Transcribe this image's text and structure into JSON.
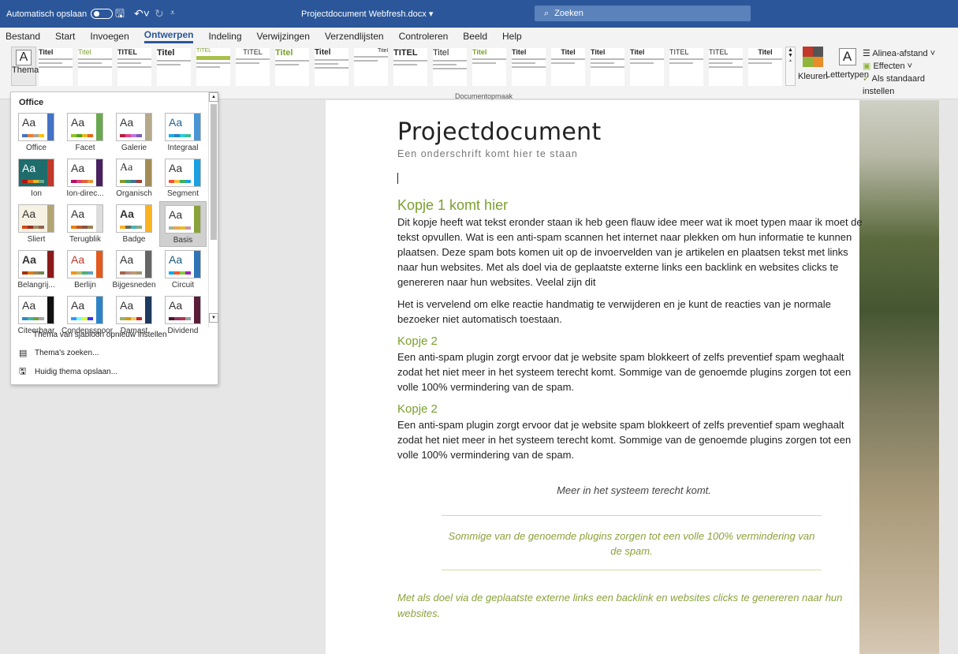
{
  "titlebar": {
    "autosave_label": "Automatisch opslaan",
    "autosave_state": "off",
    "document_title": "Projectdocument Webfresh.docx ▾",
    "search_placeholder": "Zoeken"
  },
  "menu": {
    "tabs": [
      "Bestand",
      "Start",
      "Invoegen",
      "Ontwerpen",
      "Indeling",
      "Verwijzingen",
      "Verzendlijsten",
      "Controleren",
      "Beeld",
      "Help"
    ],
    "active_tab": "Ontwerpen"
  },
  "ribbon": {
    "themes_label": "Thema's",
    "group_label": "Documentopmaak",
    "colors_label": "Kleuren",
    "fonts_label": "Lettertypen",
    "paragraph_spacing_label": "Alinea-afstand ˅",
    "effects_label": "Effecten ˅",
    "set_default_label": "Als standaard instellen",
    "style_titles": [
      "Titel",
      "Titel",
      "TITEL",
      "Titel",
      "TITEL",
      "TITEL",
      "Titel",
      "Titel",
      "Titel",
      "TITEL",
      "Titel",
      "Titel",
      "Titel",
      "Titel",
      "Titel",
      "Titel",
      "TITEL",
      "TITEL",
      "Titel"
    ]
  },
  "theme_panel": {
    "header": "Office",
    "themes": [
      "Office",
      "Facet",
      "Galerie",
      "Integraal",
      "Ion",
      "Ion-direc...",
      "Organisch",
      "Segment",
      "Sliert",
      "Terugblik",
      "Badge",
      "Basis",
      "Belangrij...",
      "Berlijn",
      "Bijgesneden",
      "Circuit",
      "Citeerbaar",
      "Condensspoor",
      "Damast",
      "Dividend"
    ],
    "selected_theme": "Basis",
    "reset_label": "Thema van sjabloon opnieuw instellen",
    "browse_label": "Thema's zoeken...",
    "save_label": "Huidig thema opslaan..."
  },
  "document": {
    "title": "Projectdocument",
    "subtitle": "Een onderschrift komt hier te staan",
    "heading1": "Kopje 1 komt hier",
    "para1": "Dit kopje heeft wat tekst eronder staan ik heb geen flauw idee meer wat ik moet typen maar ik moet de tekst opvullen. Wat is een anti-spam scannen het internet naar plekken om hun informatie te kunnen plaatsen. Deze spam bots komen uit op de invoervelden van je artikelen en plaatsen tekst met links naar hun websites. Met als doel via de geplaatste externe links een backlink en websites clicks te genereren naar hun websites. Veelal zijn dit",
    "para2": "Het is vervelend om elke reactie handmatig te verwijderen en je kunt de reacties van je normale bezoeker niet automatisch toestaan.",
    "heading2a": "Kopje 2",
    "para3": "Een anti-spam plugin zorgt ervoor dat je website spam blokkeert of zelfs preventief spam weghaalt zodat het niet meer in het systeem terecht komt. Sommige van de genoemde plugins zorgen tot een volle 100% vermindering van de spam.",
    "heading2b": "Kopje 2",
    "para4": "Een anti-spam plugin zorgt ervoor dat je website spam blokkeert of zelfs preventief spam weghaalt zodat het niet meer in het systeem terecht komt. Sommige van de genoemde plugins zorgen tot een volle 100% vermindering van de spam.",
    "quote": "Meer in het systeem terecht komt.",
    "intense_quote": "Sommige van de genoemde plugins zorgen tot een volle 100% vermindering van de spam.",
    "emphasis": "Met als doel via de geplaatste externe links een backlink en websites clicks te genereren naar hun websites."
  },
  "colors": {
    "titlebar": "#2b579a",
    "accent_green": "#7aa02e"
  }
}
